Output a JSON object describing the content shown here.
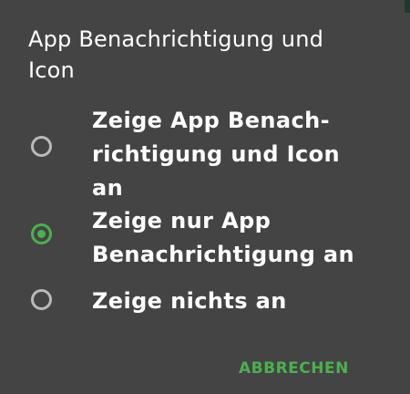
{
  "dialog": {
    "title_line1": "App Benachrichtigung und",
    "title_line2": "Icon",
    "accent_color": "#4caf50",
    "options": [
      {
        "lines": [
          "Zeige App Benach-",
          "richtigung und Icon",
          "an"
        ],
        "checked": false
      },
      {
        "lines": [
          "Zeige nur App",
          "Benachrichtigung an"
        ],
        "checked": true
      },
      {
        "lines": [
          "Zeige nichts an"
        ],
        "checked": false
      }
    ],
    "cancel_label": "ABBRECHEN"
  }
}
